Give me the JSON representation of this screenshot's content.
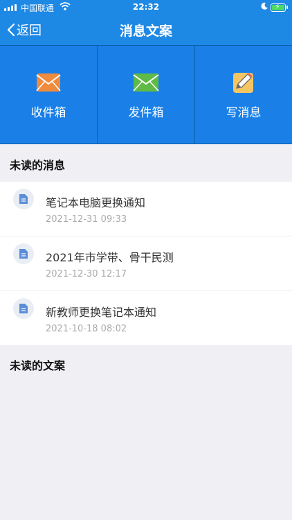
{
  "status_bar": {
    "carrier": "中国联通",
    "time": "22:32"
  },
  "nav": {
    "back_label": "返回",
    "title": "消息文案"
  },
  "tiles": [
    {
      "label": "收件箱",
      "icon": "envelope-icon",
      "color": "#f08a3c"
    },
    {
      "label": "发件箱",
      "icon": "envelope-icon",
      "color": "#5fba46"
    },
    {
      "label": "写消息",
      "icon": "pencil-note-icon",
      "color": "#f3c563"
    }
  ],
  "unread_messages": {
    "heading": "未读的消息",
    "items": [
      {
        "title": "笔记本电脑更换通知",
        "date": "2021-12-31 09:33"
      },
      {
        "title": "2021年市学带、骨干民测",
        "date": "2021-12-30 12:17"
      },
      {
        "title": "新教师更换笔记本通知",
        "date": "2021-10-18 08:02"
      }
    ]
  },
  "unread_copy": {
    "heading": "未读的文案"
  },
  "colors": {
    "brand_blue": "#1e88e5",
    "tile_blue": "#1a80e8",
    "doc_icon": "#5b8ed6"
  }
}
